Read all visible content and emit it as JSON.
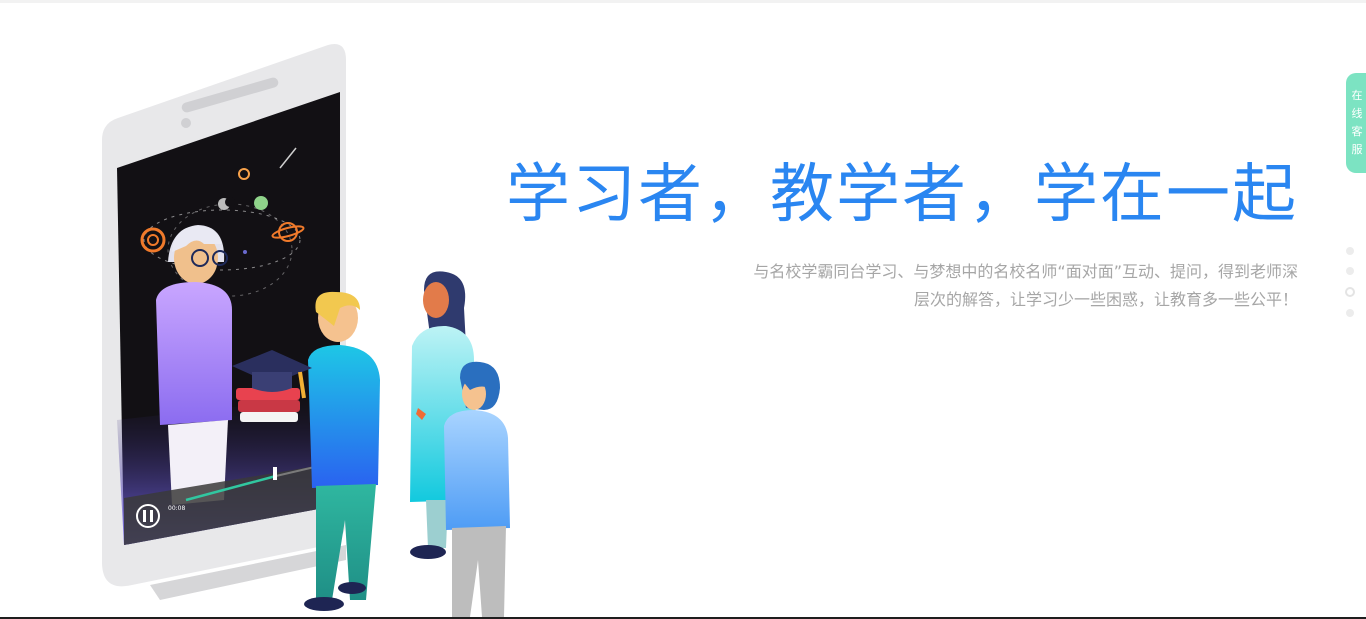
{
  "hero": {
    "title": "学习者，教学者，学在一起",
    "description_line1": "与名校学霸同台学习、与梦想中的名校名师“面对面”互动、提问，得到老师深",
    "description_line2": "层次的解答，让学习少一些困惑，让教育多一些公平！"
  },
  "video_player": {
    "time": "00:08"
  },
  "service_tab": {
    "chars": [
      "在",
      "线",
      "客",
      "服"
    ]
  },
  "slider": {
    "active_index": 2
  },
  "colors": {
    "title": "#2a86f1",
    "description": "#a6a6a6",
    "service_tab": "#7ce3c2"
  }
}
